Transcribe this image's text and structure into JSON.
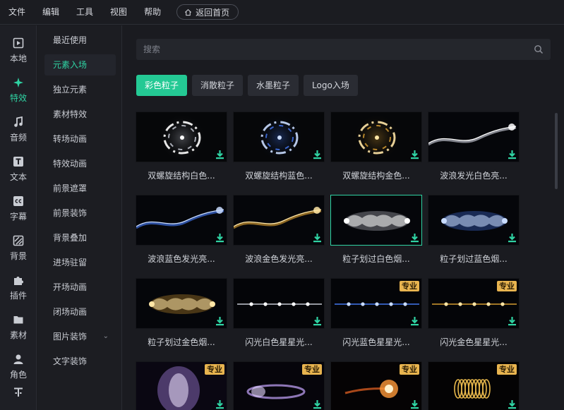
{
  "menubar": {
    "items": [
      "文件",
      "编辑",
      "工具",
      "视图",
      "帮助"
    ],
    "home_button": "返回首页"
  },
  "rail": {
    "items": [
      {
        "label": "本地",
        "icon": "film-icon",
        "active": false
      },
      {
        "label": "特效",
        "icon": "sparkle-icon",
        "active": true
      },
      {
        "label": "音频",
        "icon": "music-note-icon",
        "active": false
      },
      {
        "label": "文本",
        "icon": "text-icon",
        "active": false
      },
      {
        "label": "字幕",
        "icon": "caption-icon",
        "active": false
      },
      {
        "label": "背景",
        "icon": "background-icon",
        "active": false
      },
      {
        "label": "插件",
        "icon": "puzzle-icon",
        "active": false
      },
      {
        "label": "素材",
        "icon": "folder-icon",
        "active": false
      },
      {
        "label": "角色",
        "icon": "person-icon",
        "active": false
      }
    ]
  },
  "categories": {
    "items": [
      {
        "label": "最近使用",
        "active": false
      },
      {
        "label": "元素入场",
        "active": true
      },
      {
        "label": "独立元素",
        "active": false
      },
      {
        "label": "素材特效",
        "active": false
      },
      {
        "label": "转场动画",
        "active": false
      },
      {
        "label": "特效动画",
        "active": false
      },
      {
        "label": "前景遮罩",
        "active": false
      },
      {
        "label": "前景装饰",
        "active": false
      },
      {
        "label": "背景叠加",
        "active": false
      },
      {
        "label": "进场驻留",
        "active": false
      },
      {
        "label": "开场动画",
        "active": false
      },
      {
        "label": "闭场动画",
        "active": false
      },
      {
        "label": "图片装饰",
        "active": false,
        "has_chevron": true
      },
      {
        "label": "文字装饰",
        "active": false
      }
    ]
  },
  "search": {
    "placeholder": "搜索"
  },
  "chips": [
    {
      "label": "彩色粒子",
      "active": true
    },
    {
      "label": "消散粒子",
      "active": false
    },
    {
      "label": "水墨粒子",
      "active": false
    },
    {
      "label": "Logo入场",
      "active": false
    }
  ],
  "badge_label": "专业",
  "cards": [
    {
      "label": "双螺旋结构白色...",
      "art": "ring-white",
      "pro": false,
      "selected": false
    },
    {
      "label": "双螺旋结构蓝色...",
      "art": "ring-blue",
      "pro": false,
      "selected": false
    },
    {
      "label": "双螺旋结构金色...",
      "art": "ring-gold",
      "pro": false,
      "selected": false
    },
    {
      "label": "波浪发光白色亮...",
      "art": "wave-white",
      "pro": false,
      "selected": false
    },
    {
      "label": "波浪蓝色发光亮...",
      "art": "wave-blue",
      "pro": false,
      "selected": false
    },
    {
      "label": "波浪金色发光亮...",
      "art": "wave-gold",
      "pro": false,
      "selected": false
    },
    {
      "label": "粒子划过白色烟...",
      "art": "smoke-white",
      "pro": false,
      "selected": true
    },
    {
      "label": "粒子划过蓝色烟...",
      "art": "smoke-blue",
      "pro": false,
      "selected": false
    },
    {
      "label": "粒子划过金色烟...",
      "art": "smoke-gold",
      "pro": false,
      "selected": false
    },
    {
      "label": "闪光白色星星光...",
      "art": "flash-white",
      "pro": false,
      "selected": false
    },
    {
      "label": "闪光蓝色星星光...",
      "art": "flash-blue",
      "pro": true,
      "selected": false
    },
    {
      "label": "闪光金色星星光...",
      "art": "flash-gold",
      "pro": true,
      "selected": false
    },
    {
      "label": "",
      "art": "purple-burst",
      "pro": true,
      "selected": false
    },
    {
      "label": "",
      "art": "purple-swirl",
      "pro": true,
      "selected": false
    },
    {
      "label": "",
      "art": "fire-burst",
      "pro": true,
      "selected": false
    },
    {
      "label": "",
      "art": "gold-spring",
      "pro": true,
      "selected": false
    }
  ],
  "colors": {
    "accent": "#24c994",
    "accent_text": "#2fd3a3",
    "badge": "#e8b44f",
    "background": "#1a1b20"
  }
}
